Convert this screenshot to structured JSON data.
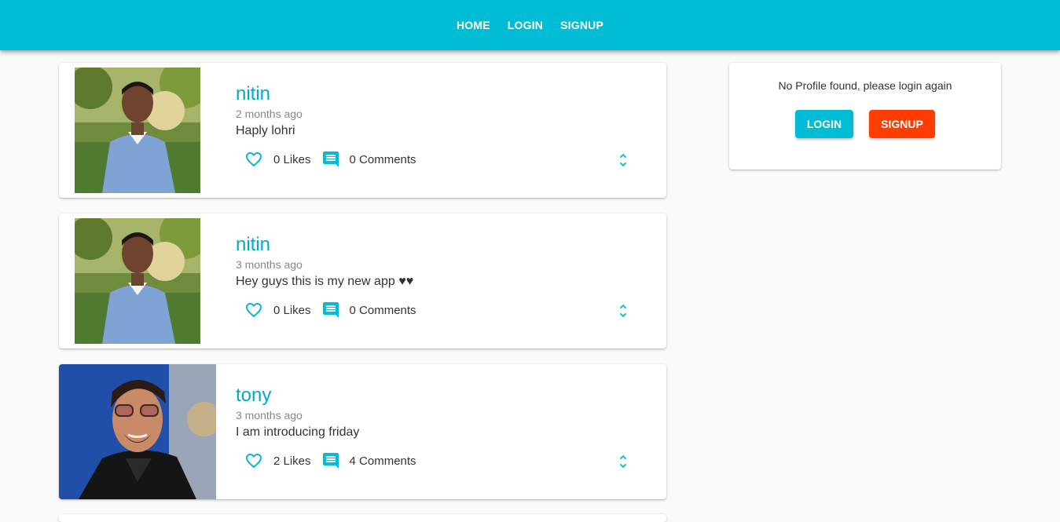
{
  "nav": {
    "home": "HOME",
    "login": "LOGIN",
    "signup": "SIGNUP"
  },
  "posts": [
    {
      "user": "nitin",
      "time": "2 months ago",
      "body": "Haply lohri",
      "likes": "0 Likes",
      "comments": "0 Comments"
    },
    {
      "user": "nitin",
      "time": "3 months ago",
      "body": "Hey guys this is my new app ♥♥",
      "likes": "0 Likes",
      "comments": "0 Comments"
    },
    {
      "user": "tony",
      "time": "3 months ago",
      "body": "I am introducing friday",
      "likes": "2 Likes",
      "comments": "4 Comments"
    }
  ],
  "profile": {
    "message": "No Profile found, please login again",
    "login_label": "LOGIN",
    "signup_label": "SIGNUP"
  },
  "colors": {
    "primary": "#00bcd4",
    "accent": "#ff3d00",
    "username": "#00acc1"
  },
  "icons": [
    "heart-outline-icon",
    "comment-icon",
    "unfold-more-icon"
  ]
}
